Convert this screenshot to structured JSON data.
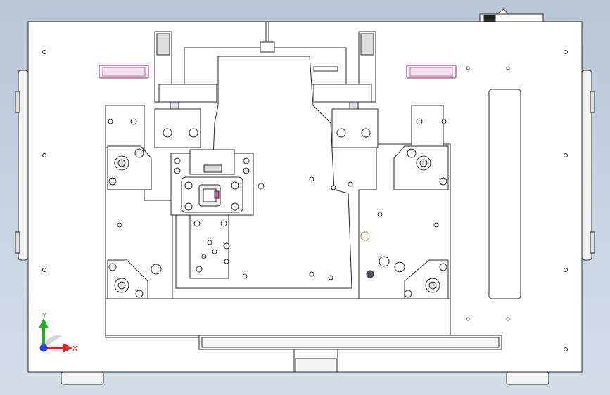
{
  "viewport": {
    "background_top": "#b9c6d6",
    "background_bottom": "#d5dde7"
  },
  "model": {
    "line_color": "#2b2b2b",
    "body_fill": "#ffffff",
    "shade_fill": "#eeeeee",
    "accent_color": "#c8609e",
    "label_pad_color": "#c8609e"
  },
  "triad": {
    "x_label": "X",
    "y_label": "Y",
    "x_color": "#e02020",
    "y_color": "#20b020",
    "z_color": "#2040e0"
  }
}
